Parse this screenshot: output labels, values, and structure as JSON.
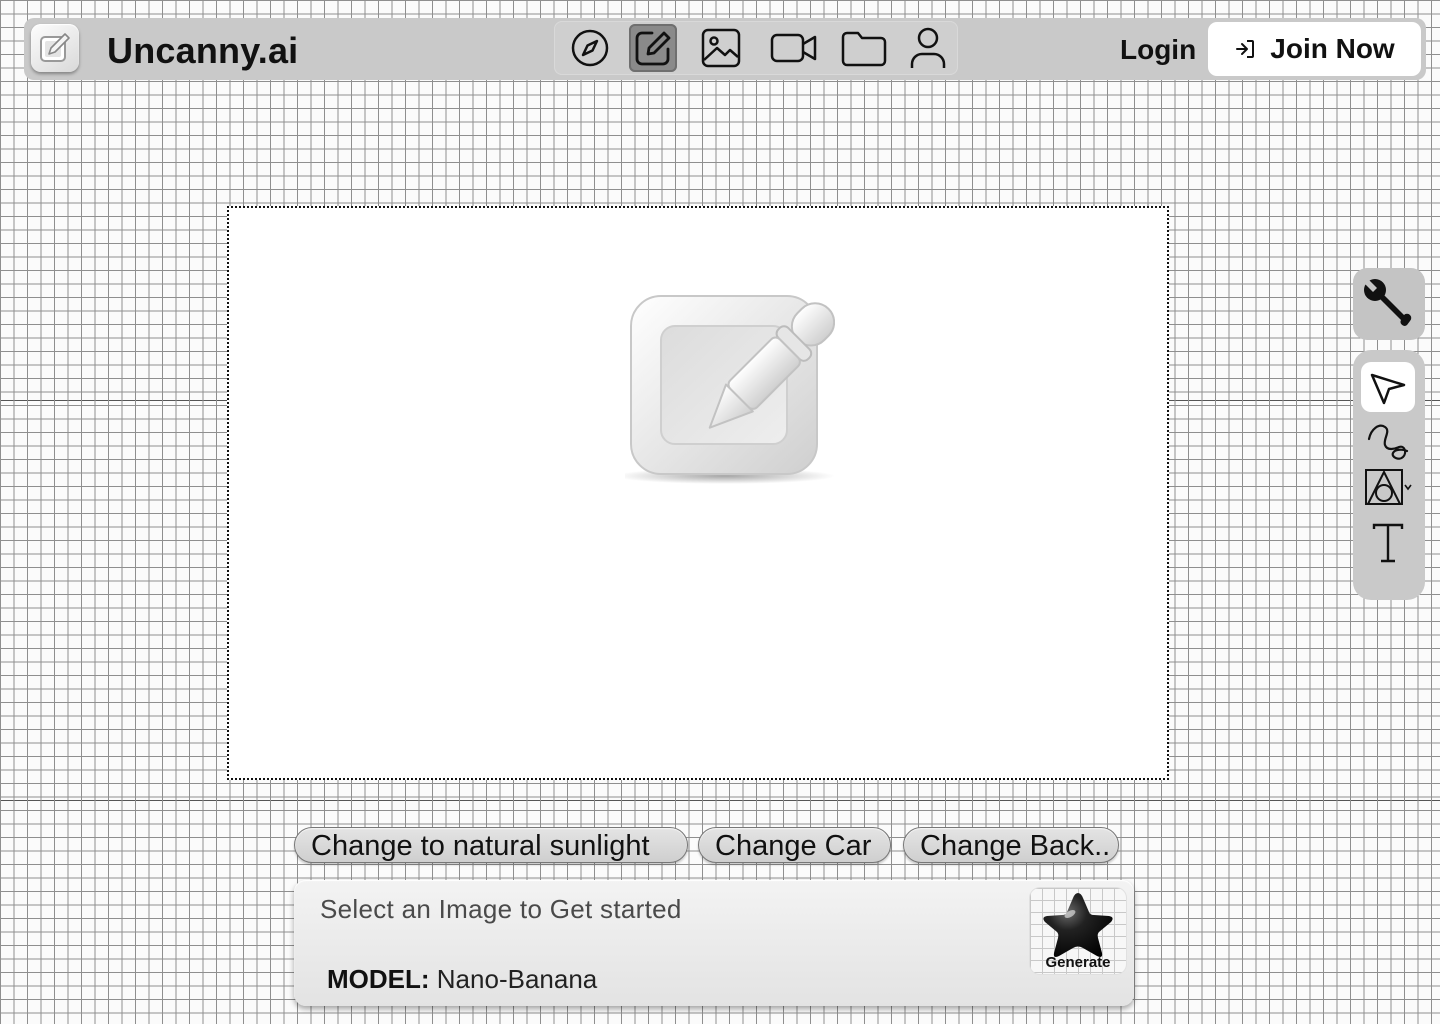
{
  "app": {
    "brand": "Uncanny.ai",
    "logo_icon": "edit-square-icon"
  },
  "nav": {
    "items": [
      {
        "name": "explore",
        "icon": "compass-icon",
        "active": false
      },
      {
        "name": "edit",
        "icon": "pencil-square-icon",
        "active": true
      },
      {
        "name": "images",
        "icon": "image-icon",
        "active": false
      },
      {
        "name": "video",
        "icon": "video-camera-icon",
        "active": false
      },
      {
        "name": "files",
        "icon": "folder-icon",
        "active": false
      },
      {
        "name": "profile",
        "icon": "user-icon",
        "active": false
      }
    ]
  },
  "auth": {
    "login_label": "Login",
    "join_label": "Join Now",
    "join_icon": "sign-in-icon"
  },
  "canvas": {
    "placeholder_icon": "edit-square-3d-icon"
  },
  "toolbar": {
    "settings_icon": "wrench-icon",
    "tools": [
      {
        "name": "select",
        "icon": "cursor-arrow-icon",
        "active": true
      },
      {
        "name": "draw",
        "icon": "squiggle-icon",
        "active": false
      },
      {
        "name": "shapes",
        "icon": "shapes-icon",
        "active": false
      },
      {
        "name": "text",
        "icon": "text-icon",
        "active": false
      }
    ]
  },
  "suggestions": [
    "Change to natural sunlight",
    "Change Car",
    "Change Back.."
  ],
  "prompt": {
    "placeholder": "Select an Image to Get started",
    "model_label": "MODEL:",
    "model_value": "Nano-Banana",
    "generate_label": "Generate",
    "generate_icon": "star-icon"
  },
  "colors": {
    "bar_bg": "#c9c9c9",
    "active_nav": "#8a8a8a",
    "text": "#111111"
  }
}
